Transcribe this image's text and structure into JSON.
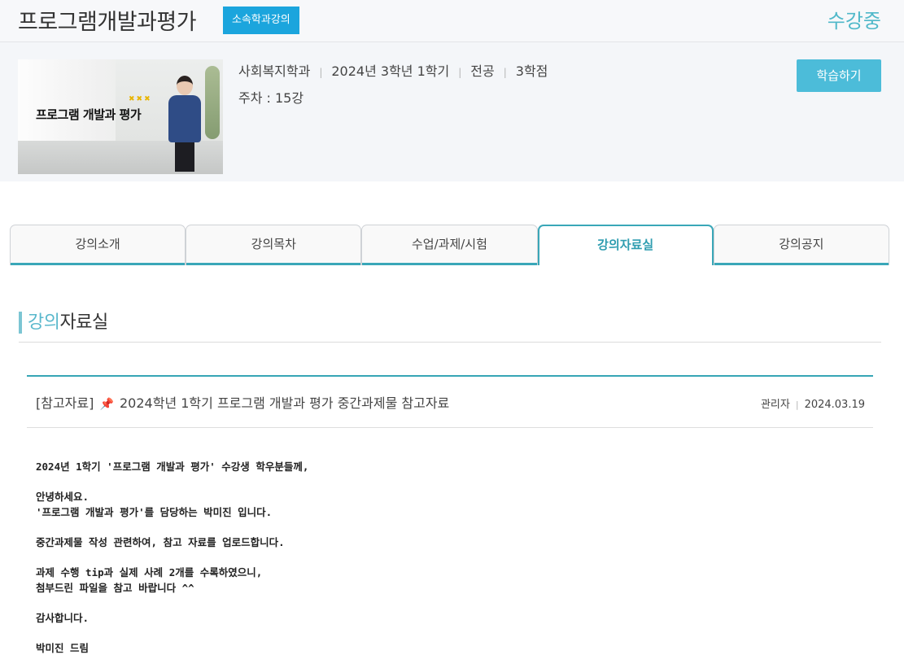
{
  "header": {
    "title": "프로그램개발과평가",
    "badge": "소속학과강의",
    "status": "수강중"
  },
  "info": {
    "thumbnail_text": "프로그램 개발과 평가",
    "department": "사회복지학과",
    "term": "2024년  3학년 1학기",
    "category": "전공",
    "credits": "3학점",
    "weeks": "주차 : 15강",
    "learn_button": "학습하기"
  },
  "tabs": [
    {
      "label": "강의소개"
    },
    {
      "label": "강의목차"
    },
    {
      "label": "수업/과제/시험"
    },
    {
      "label": "강의자료실",
      "active": true
    },
    {
      "label": "강의공지"
    }
  ],
  "section": {
    "title_accent": "강의",
    "title_rest": "자료실"
  },
  "post": {
    "category": "[참고자료]",
    "title": "2024학년 1학기 프로그램 개발과 평가 중간과제물 참고자료",
    "author": "관리자",
    "date": "2024.03.19",
    "body": [
      "2024년 1학기 '프로그램 개발과 평가' 수강생 학우분들께,",
      "",
      "안녕하세요.",
      "'프로그램 개발과 평가'를 담당하는 박미진 입니다.",
      "",
      "중간과제물 작성 관련하여, 참고 자료를 업로드합니다.",
      "",
      "과제 수행 tip과 실제 사례 2개를 수록하였으니,",
      "첨부드린 파일을 참고 바랍니다 ^^",
      "",
      "감사합니다.",
      "",
      "박미진 드림"
    ]
  },
  "colors": {
    "accent": "#3aa7b8",
    "badge": "#1ba5dd",
    "button": "#4cbcd9"
  }
}
